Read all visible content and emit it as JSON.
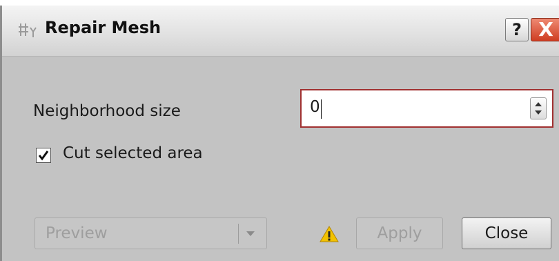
{
  "window": {
    "title": "Repair Mesh",
    "icon": "mesh-tool-icon",
    "help_label": "?",
    "close_label": "X"
  },
  "form": {
    "neighborhood_label": "Neighborhood size",
    "neighborhood_value": "0",
    "cut_label": "Cut selected area",
    "cut_checked": true
  },
  "footer": {
    "preview_label": "Preview",
    "warning_icon": "warning-icon",
    "apply_label": "Apply",
    "close_label": "Close"
  },
  "colors": {
    "dialog_background": "#c3c3c3",
    "focus_border": "#a03030",
    "close_button_red": "#cf3d22",
    "warning_yellow": "#f2c200"
  }
}
